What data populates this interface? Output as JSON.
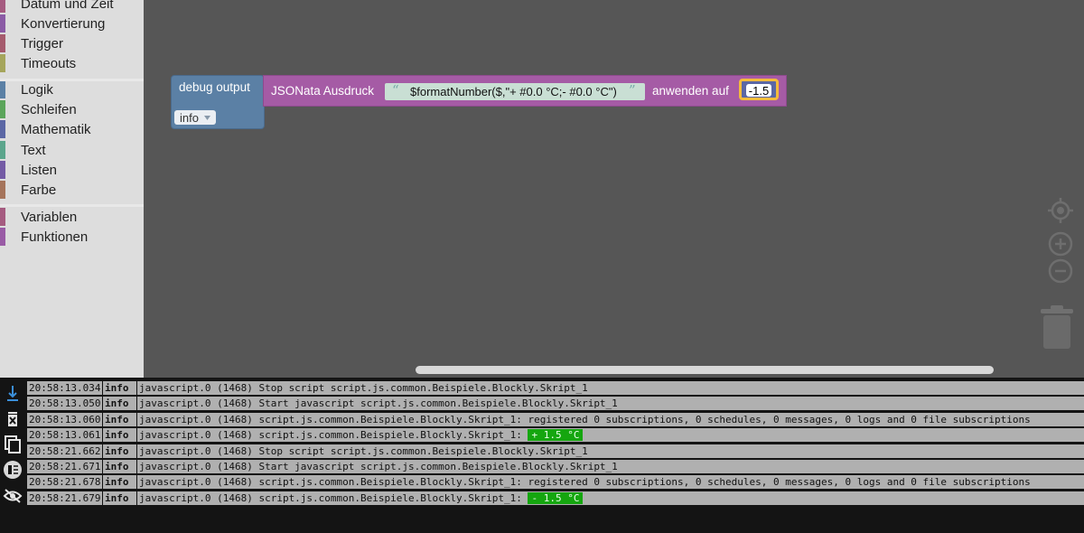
{
  "toolbox": {
    "items": [
      {
        "label": "Datum und Zeit",
        "color": "#a55b80"
      },
      {
        "label": "Konvertierung",
        "color": "#8b5ba5"
      },
      {
        "label": "Trigger",
        "color": "#a55b6d"
      },
      {
        "label": "Timeouts",
        "color": "#a5a55b"
      },
      {
        "label": "Logik",
        "color": "#5b80a5"
      },
      {
        "label": "Schleifen",
        "color": "#5ba55b"
      },
      {
        "label": "Mathematik",
        "color": "#5b67a5"
      },
      {
        "label": "Text",
        "color": "#5ba58c"
      },
      {
        "label": "Listen",
        "color": "#745ba5"
      },
      {
        "label": "Farbe",
        "color": "#a5745b"
      },
      {
        "label": "Variablen",
        "color": "#a55b80"
      },
      {
        "label": "Funktionen",
        "color": "#995ba5"
      }
    ]
  },
  "workspace": {
    "debug_block": {
      "label": "debug output",
      "level": "info"
    },
    "jsonata_block": {
      "label": "JSONata Ausdruck",
      "expression": "$formatNumber($,\"+ #0.0 °C;- #0.0 °C\")",
      "apply_label": "anwenden auf",
      "value": "-1.5"
    },
    "icons": [
      "locate-icon",
      "zoom-in-icon",
      "zoom-out-icon",
      "trash-icon"
    ]
  },
  "log": {
    "sidebar_icons": [
      "scroll-bottom-icon",
      "clear-log-icon",
      "copy-icon",
      "columns-icon",
      "hide-icon"
    ],
    "rows": [
      {
        "time": "20:58:13.034",
        "severity": "info",
        "message": "javascript.0 (1468) Stop script script.js.common.Beispiele.Blockly.Skript_1",
        "highlight": ""
      },
      {
        "time": "20:58:13.050",
        "severity": "info",
        "message": "javascript.0 (1468) Start javascript script.js.common.Beispiele.Blockly.Skript_1",
        "highlight": ""
      },
      {
        "time": "20:58:13.060",
        "severity": "info",
        "message": "javascript.0 (1468) script.js.common.Beispiele.Blockly.Skript_1: registered 0 subscriptions, 0 schedules, 0 messages, 0 logs and 0 file subscriptions",
        "highlight": ""
      },
      {
        "time": "20:58:13.061",
        "severity": "info",
        "message": "javascript.0 (1468) script.js.common.Beispiele.Blockly.Skript_1: ",
        "highlight": "+ 1.5 °C"
      },
      {
        "time": "20:58:21.662",
        "severity": "info",
        "message": "javascript.0 (1468) Stop script script.js.common.Beispiele.Blockly.Skript_1",
        "highlight": ""
      },
      {
        "time": "20:58:21.671",
        "severity": "info",
        "message": "javascript.0 (1468) Start javascript script.js.common.Beispiele.Blockly.Skript_1",
        "highlight": ""
      },
      {
        "time": "20:58:21.678",
        "severity": "info",
        "message": "javascript.0 (1468) script.js.common.Beispiele.Blockly.Skript_1: registered 0 subscriptions, 0 schedules, 0 messages, 0 logs and 0 file subscriptions",
        "highlight": ""
      },
      {
        "time": "20:58:21.679",
        "severity": "info",
        "message": "javascript.0 (1468) script.js.common.Beispiele.Blockly.Skript_1: ",
        "highlight": "- 1.5 °C"
      }
    ]
  },
  "colors": {
    "log_highlight": "#15a60f",
    "field_outline": "#f4bb3c"
  }
}
